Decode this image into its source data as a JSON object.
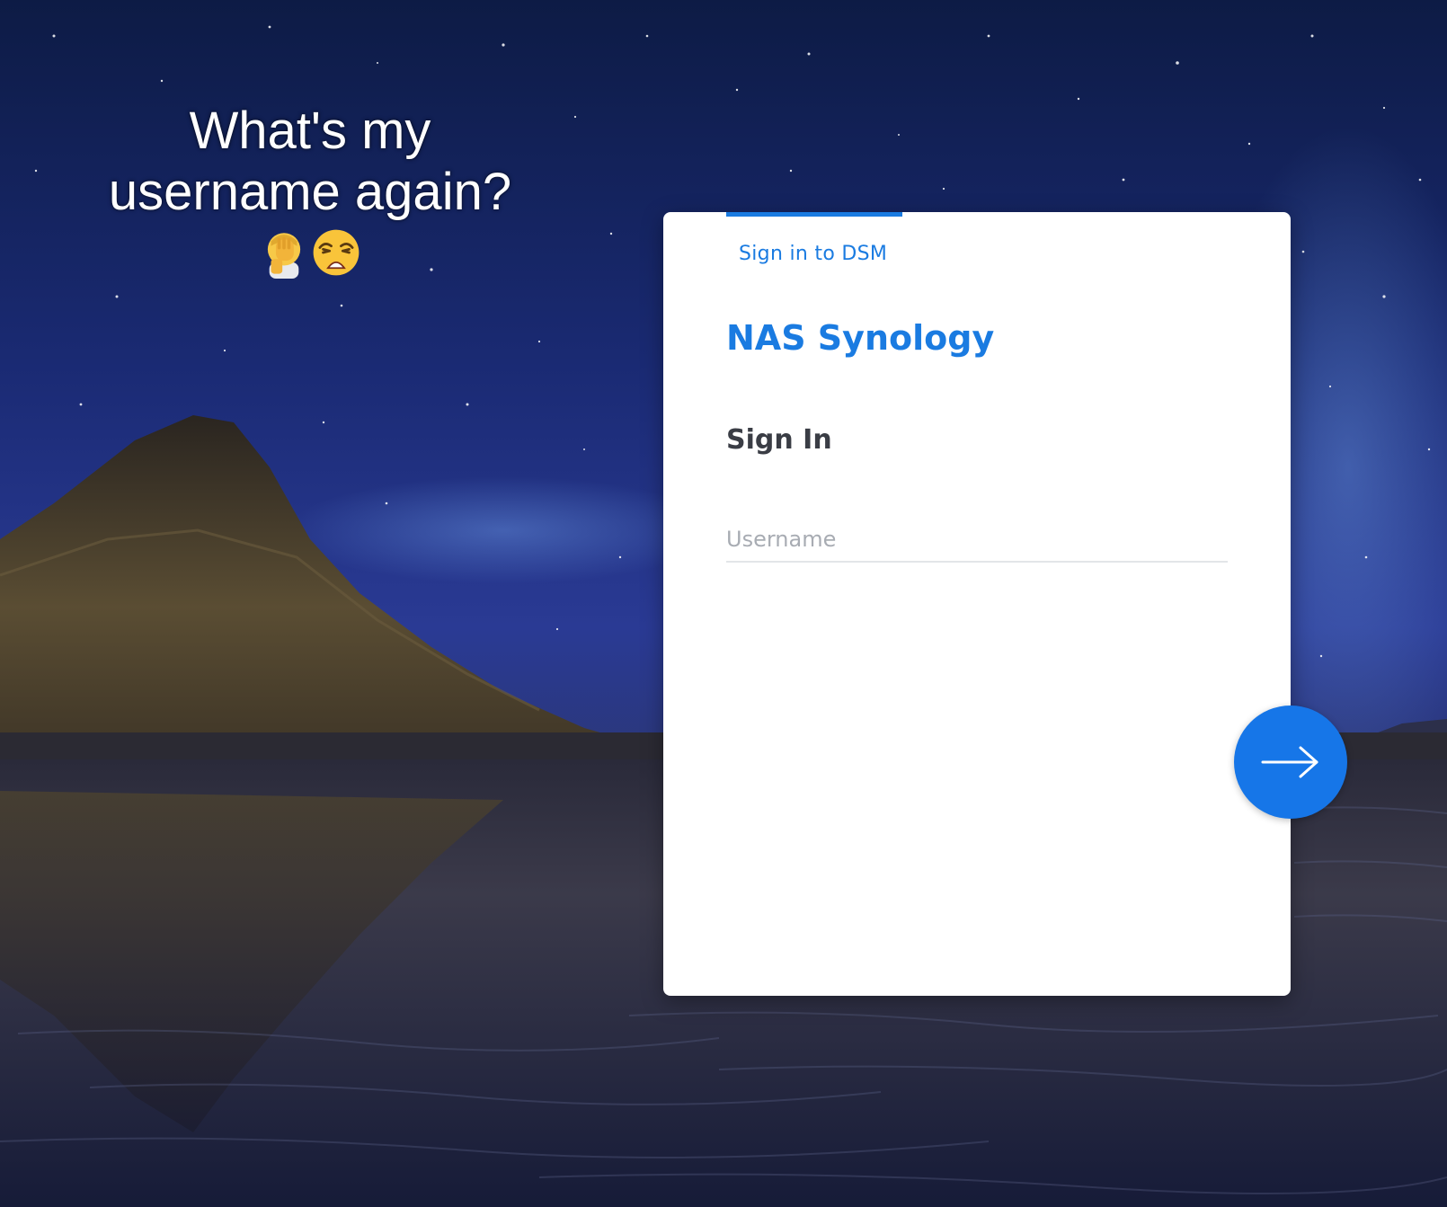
{
  "meme": {
    "line1": "What's my",
    "line2": "username again?",
    "emojis": [
      "facepalm-emoji",
      "weary-face-emoji"
    ]
  },
  "login": {
    "tab_label": "Sign in to DSM",
    "brand_name": "NAS Synology",
    "heading": "Sign In",
    "username": {
      "value": "",
      "placeholder": "Username"
    },
    "next_button_icon": "arrow-right-icon"
  },
  "colors": {
    "accent": "#1a7be1",
    "button": "#1676e8",
    "heading_text": "#3a3d45",
    "placeholder_text": "#a8acb3"
  }
}
